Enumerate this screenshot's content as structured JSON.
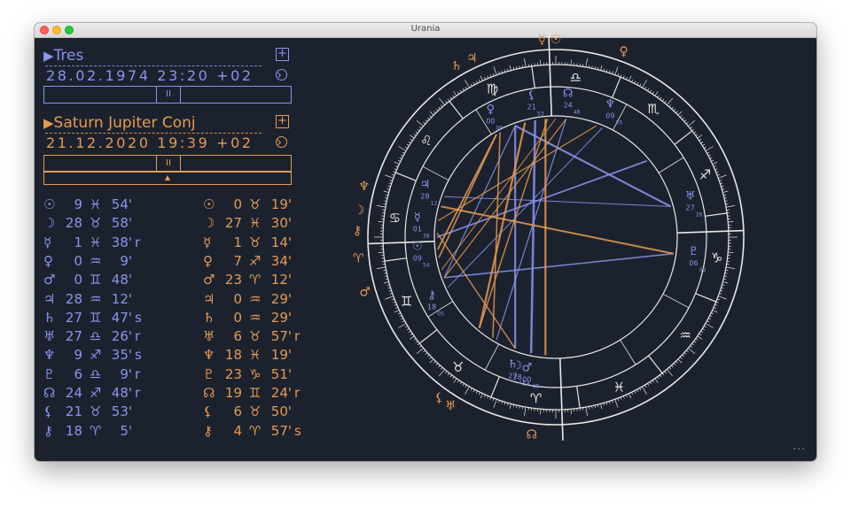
{
  "window": {
    "title": "Urania"
  },
  "chart1": {
    "name": "Tres",
    "datetime": "28.02.1974  23:20  +02",
    "color": "#8b93f0",
    "positions": [
      {
        "glyph": "☉",
        "deg": "9",
        "sign": "♓",
        "min": "54'",
        "flag": ""
      },
      {
        "glyph": "☽",
        "deg": "28",
        "sign": "♉",
        "min": "58'",
        "flag": ""
      },
      {
        "glyph": "☿",
        "deg": "1",
        "sign": "♓",
        "min": "38'",
        "flag": "r"
      },
      {
        "glyph": "♀",
        "deg": "0",
        "sign": "♒",
        "min": "9'",
        "flag": ""
      },
      {
        "glyph": "♂",
        "deg": "0",
        "sign": "♊",
        "min": "48'",
        "flag": ""
      },
      {
        "glyph": "♃",
        "deg": "28",
        "sign": "♒",
        "min": "12'",
        "flag": ""
      },
      {
        "glyph": "♄",
        "deg": "27",
        "sign": "♊",
        "min": "47'",
        "flag": "s"
      },
      {
        "glyph": "♅",
        "deg": "27",
        "sign": "♎",
        "min": "26'",
        "flag": "r"
      },
      {
        "glyph": "♆",
        "deg": "9",
        "sign": "♐",
        "min": "35'",
        "flag": "s"
      },
      {
        "glyph": "♇",
        "deg": "6",
        "sign": "♎",
        "min": "9'",
        "flag": "r"
      },
      {
        "glyph": "☊",
        "deg": "24",
        "sign": "♐",
        "min": "48'",
        "flag": "r"
      },
      {
        "glyph": "⚸",
        "deg": "21",
        "sign": "♉",
        "min": "53'",
        "flag": ""
      },
      {
        "glyph": "⚷",
        "deg": "18",
        "sign": "♈",
        "min": "5'",
        "flag": ""
      }
    ]
  },
  "chart2": {
    "name": "Saturn Jupiter Conj",
    "datetime": "21.12.2020  19:39  +02",
    "color": "#e59a52",
    "positions": [
      {
        "glyph": "☉",
        "deg": "0",
        "sign": "♉",
        "min": "19'",
        "flag": ""
      },
      {
        "glyph": "☽",
        "deg": "27",
        "sign": "♓",
        "min": "30'",
        "flag": ""
      },
      {
        "glyph": "☿",
        "deg": "1",
        "sign": "♉",
        "min": "14'",
        "flag": ""
      },
      {
        "glyph": "♀",
        "deg": "7",
        "sign": "♐",
        "min": "34'",
        "flag": ""
      },
      {
        "glyph": "♂",
        "deg": "23",
        "sign": "♈",
        "min": "12'",
        "flag": ""
      },
      {
        "glyph": "♃",
        "deg": "0",
        "sign": "♒",
        "min": "29'",
        "flag": ""
      },
      {
        "glyph": "♄",
        "deg": "0",
        "sign": "♒",
        "min": "29'",
        "flag": ""
      },
      {
        "glyph": "♅",
        "deg": "6",
        "sign": "♉",
        "min": "57'",
        "flag": "r"
      },
      {
        "glyph": "♆",
        "deg": "18",
        "sign": "♓",
        "min": "19'",
        "flag": ""
      },
      {
        "glyph": "♇",
        "deg": "23",
        "sign": "♑",
        "min": "51'",
        "flag": ""
      },
      {
        "glyph": "☊",
        "deg": "19",
        "sign": "♊",
        "min": "24'",
        "flag": "r"
      },
      {
        "glyph": "⚸",
        "deg": "6",
        "sign": "♉",
        "min": "50'",
        "flag": ""
      },
      {
        "glyph": "⚷",
        "deg": "4",
        "sign": "♈",
        "min": "57'",
        "flag": "s"
      }
    ]
  },
  "controls": {
    "add_label": "+",
    "pause_label": "II",
    "step_label": "▲",
    "more_label": "..."
  },
  "wheel": {
    "signs_visible": [
      "♐",
      "♏",
      "♎",
      "♍",
      "♌",
      "♋",
      "♊",
      "♉",
      "♈",
      "♓",
      "♒",
      "♑"
    ],
    "inner_planets": [
      {
        "glyph": "♀",
        "num": "00",
        "sub": "09"
      },
      {
        "glyph": "⚸",
        "num": "21",
        "sub": "53"
      },
      {
        "glyph": "☊",
        "num": "24",
        "sub": "48"
      },
      {
        "glyph": "♆",
        "num": "09",
        "sub": "35"
      },
      {
        "glyph": "♅",
        "num": "27",
        "sub": "26"
      },
      {
        "glyph": "♇",
        "num": "06",
        "sub": "09"
      },
      {
        "glyph": "♄",
        "num": "27",
        "sub": "47"
      },
      {
        "glyph": "♂",
        "num": "00",
        "sub": "48"
      },
      {
        "glyph": "☽",
        "num": "28",
        "sub": "58"
      },
      {
        "glyph": "⚷",
        "num": "18",
        "sub": "05"
      },
      {
        "glyph": "☉",
        "num": "09",
        "sub": "54"
      },
      {
        "glyph": "☿",
        "num": "01",
        "sub": "38"
      },
      {
        "glyph": "♃",
        "num": "28",
        "sub": "12"
      }
    ],
    "outer_planets": [
      "☿",
      "☉",
      "♀",
      "♄",
      "♃",
      "♆",
      "☽",
      "⚷",
      "♈",
      "♂",
      "⚸",
      "♅",
      "☊"
    ]
  }
}
